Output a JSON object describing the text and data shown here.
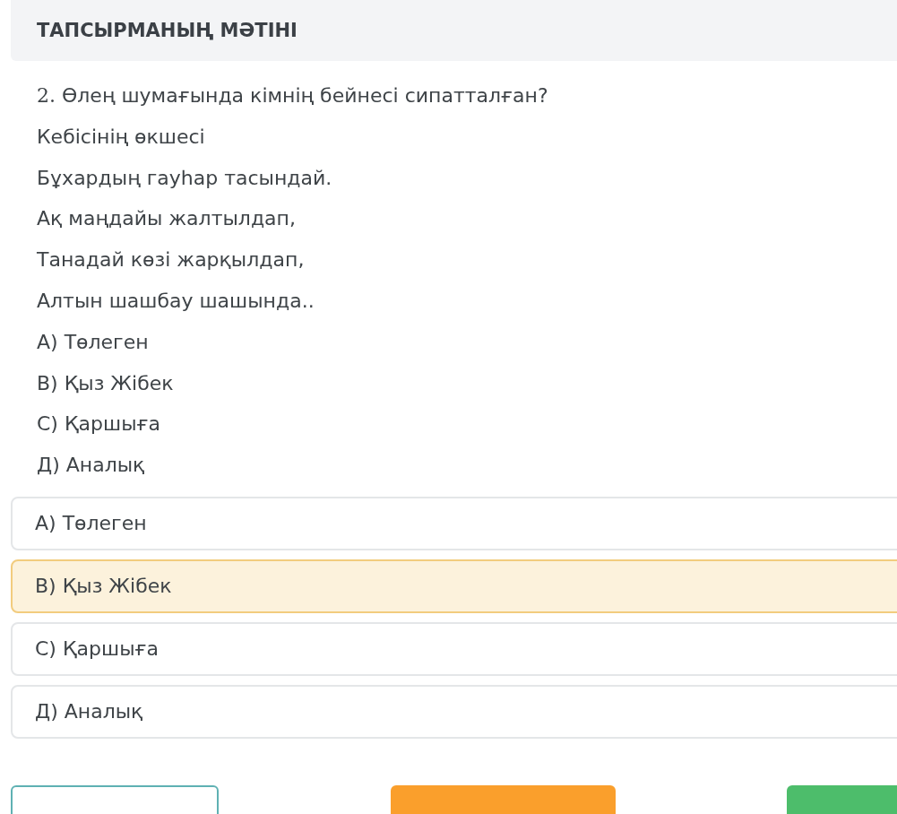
{
  "header": {
    "title": "ТАПСЫРМАНЫҢ МӘТІНІ"
  },
  "question": {
    "number": "2.",
    "text": "Өлең шумағында кімнің бейнесі сипатталған?"
  },
  "lines": [
    "Кебісінің өкшесі",
    "Бұхардың гауһар тасындай.",
    "Ақ маңдайы жалтылдап,",
    "Танадай көзі жарқылдап,",
    "Алтын шашбау шашында..",
    "А) Төлеген",
    "В) Қыз Жібек",
    "С) Қаршыға",
    "Д) Аналық"
  ],
  "options": [
    {
      "label": "А) Төлеген",
      "selected": false
    },
    {
      "label": "В) Қыз Жібек",
      "selected": true
    },
    {
      "label": "С) Қаршыға",
      "selected": false
    },
    {
      "label": "Д) Аналық",
      "selected": false
    }
  ],
  "buttons": [
    {
      "kind": "outline"
    },
    {
      "kind": "orange"
    },
    {
      "kind": "green"
    }
  ]
}
